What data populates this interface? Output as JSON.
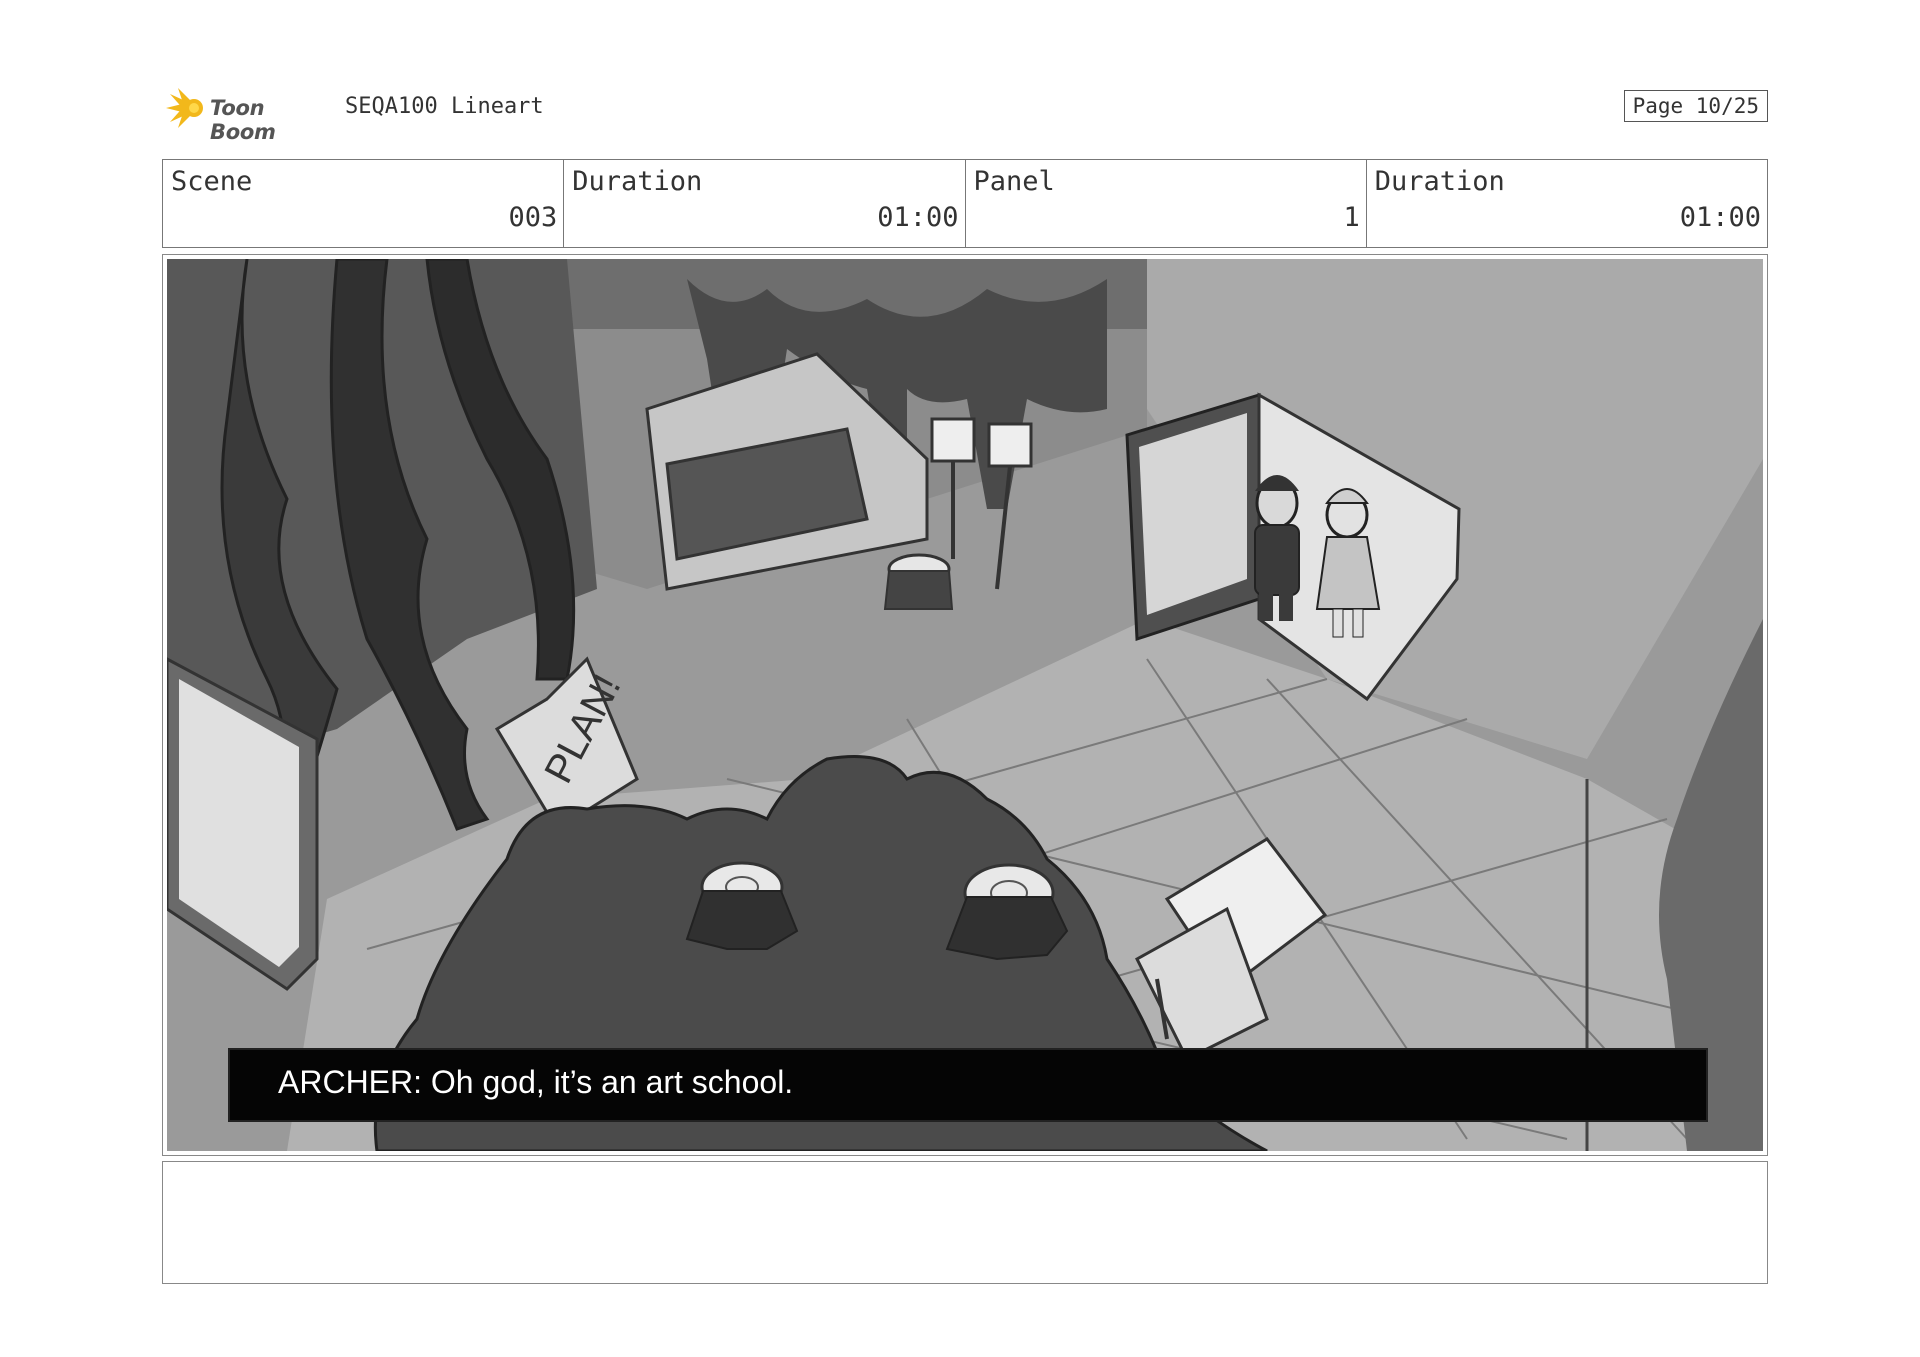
{
  "header": {
    "logo_text": "Toon Boom",
    "doc_title": "SEQA100 Lineart",
    "page_label": "Page 10/25"
  },
  "info": {
    "scene_label": "Scene",
    "scene_value": "003",
    "scene_duration_label": "Duration",
    "scene_duration_value": "01:00",
    "panel_label": "Panel",
    "panel_value": "1",
    "panel_duration_label": "Duration",
    "panel_duration_value": "01:00"
  },
  "panel": {
    "caption": "ARCHER: Oh god, it’s an art school.",
    "sign_text": "PLAN!"
  },
  "notes": {
    "text": ""
  },
  "colors": {
    "logo_accent": "#F2B81B",
    "caption_bg": "#050505",
    "caption_text": "#FFFFFF"
  }
}
